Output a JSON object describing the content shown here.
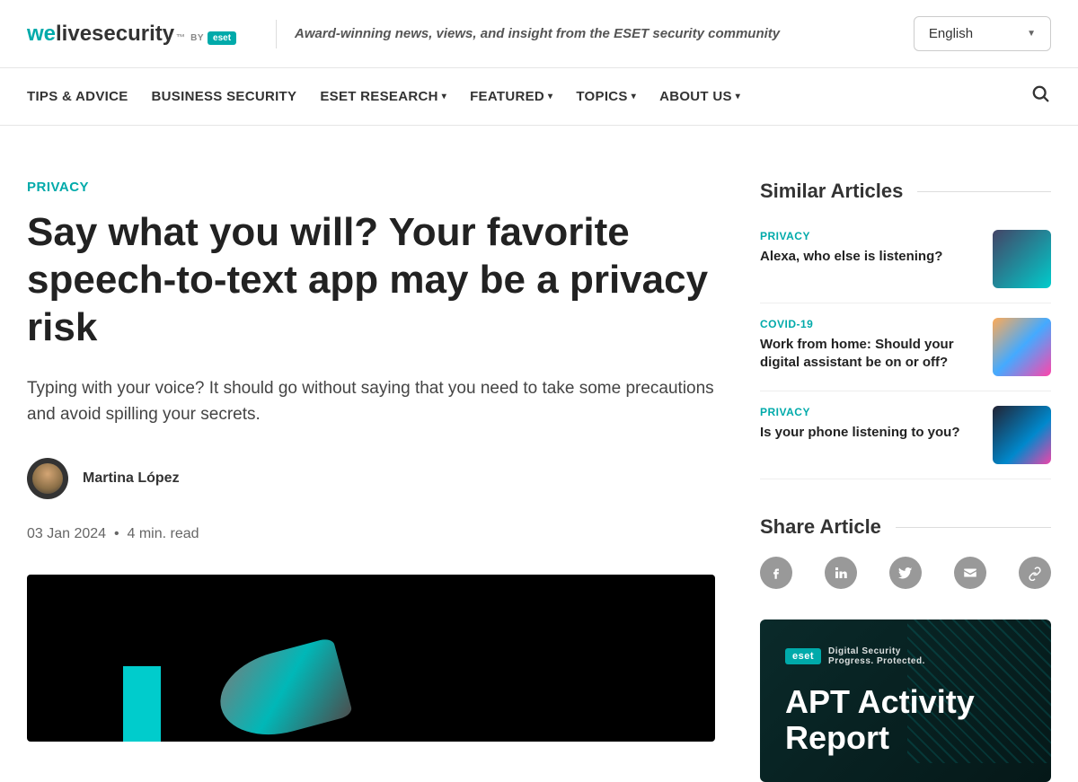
{
  "header": {
    "logo_we": "we",
    "logo_live": "live",
    "logo_security": "security",
    "logo_by": "BY",
    "logo_eset": "eset",
    "tagline": "Award-winning news, views, and insight from the ESET security community",
    "language": "English"
  },
  "nav": {
    "items": [
      {
        "label": "TIPS & ADVICE",
        "dropdown": false
      },
      {
        "label": "BUSINESS SECURITY",
        "dropdown": false
      },
      {
        "label": "ESET RESEARCH",
        "dropdown": true
      },
      {
        "label": "FEATURED",
        "dropdown": true
      },
      {
        "label": "TOPICS",
        "dropdown": true
      },
      {
        "label": "ABOUT US",
        "dropdown": true
      }
    ]
  },
  "article": {
    "category": "PRIVACY",
    "title": "Say what you will? Your favorite speech-to-text app may be a privacy risk",
    "subtitle": "Typing with your voice? It should go without saying that you need to take some precautions and avoid spilling your secrets.",
    "author": "Martina López",
    "date": "03 Jan 2024",
    "meta_separator": "•",
    "read_time": "4 min. read"
  },
  "similar": {
    "heading": "Similar Articles",
    "items": [
      {
        "category": "PRIVACY",
        "title": "Alexa, who else is listening?"
      },
      {
        "category": "COVID-19",
        "title": "Work from home: Should your digital assistant be on or off?"
      },
      {
        "category": "PRIVACY",
        "title": "Is your phone listening to you?"
      }
    ]
  },
  "share": {
    "heading": "Share Article"
  },
  "promo": {
    "brand": "eset",
    "brand_line1": "Digital Security",
    "brand_line2": "Progress. Protected.",
    "title": "APT Activity Report"
  }
}
